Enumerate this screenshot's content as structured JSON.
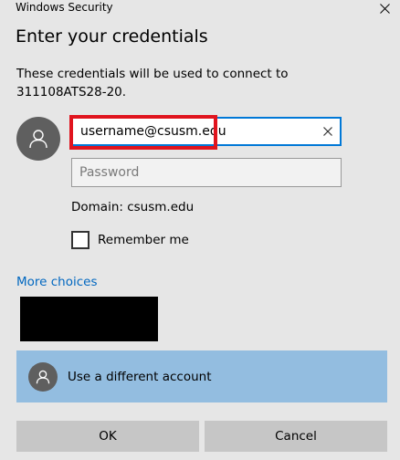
{
  "window": {
    "title": "Windows Security"
  },
  "dialog": {
    "heading": "Enter your credentials",
    "message": "These credentials will be used to connect to 311108ATS28-20."
  },
  "credentials": {
    "username_value": "username@csusm.edu",
    "password_placeholder": "Password",
    "domain_text": "Domain: csusm.edu",
    "remember_label": "Remember me",
    "remember_checked": false
  },
  "more_choices_label": "More choices",
  "account_option": {
    "label": "Use a different account"
  },
  "buttons": {
    "ok": "OK",
    "cancel": "Cancel"
  },
  "colors": {
    "background": "#e6e6e6",
    "accent_blue": "#0078d7",
    "link_blue": "#0067c0",
    "selected_row": "#93bde0",
    "highlight_red": "#e0141e",
    "avatar_gray": "#5f5f5f",
    "button_gray": "#c6c6c6"
  },
  "icons": {
    "close": "close-icon",
    "clear": "clear-icon",
    "user": "user-icon"
  }
}
